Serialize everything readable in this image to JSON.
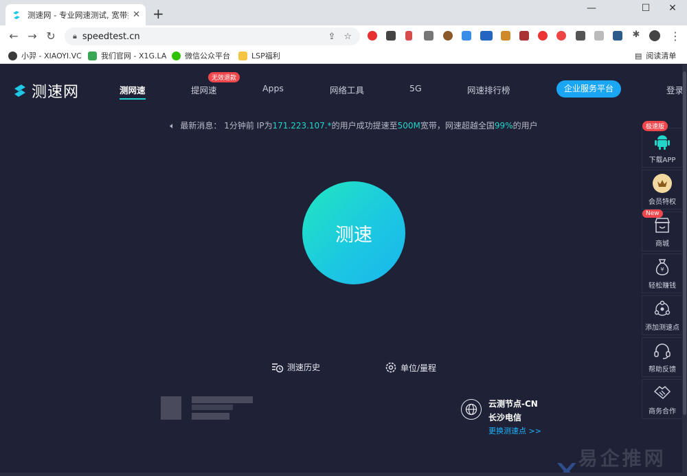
{
  "browser": {
    "tab_title": "测速网 - 专业网速测试, 宽带提速",
    "url": "speedtest.cn",
    "window_controls": {
      "minimize": "—",
      "maximize": "☐",
      "close": "✕"
    }
  },
  "bookmarks": [
    {
      "label": "小羿 - XIAOYI.VC",
      "color": "#3a3a3a"
    },
    {
      "label": "我们官网 - X1G.LA",
      "color": "#3aa756"
    },
    {
      "label": "微信公众平台",
      "color": "#2dc100"
    },
    {
      "label": "LSP福利",
      "color": "#f4c542"
    }
  ],
  "reading_list": "阅读清单",
  "site": {
    "logo": "测速网",
    "nav": [
      {
        "label": "测网速",
        "active": true
      },
      {
        "label": "提网速",
        "active": false
      },
      {
        "label": "Apps",
        "active": false
      },
      {
        "label": "网络工具",
        "active": false
      },
      {
        "label": "5G",
        "active": false
      },
      {
        "label": "网速排行榜",
        "active": false
      }
    ],
    "nav_badge": "无效退款",
    "enterprise": "企业服务平台",
    "login": "登录",
    "news": {
      "prefix": "最新消息：  1分钟前 IP为",
      "ip": "171.223.107.*",
      "mid": "的用户成功提速至",
      "speed": "500M",
      "mid2": "宽带，网速超越全国",
      "pct": "99%",
      "suffix": "的用户"
    },
    "speed_button": "测速",
    "history": "测速历史",
    "units": "单位/量程",
    "node": {
      "name": "云测节点-CN",
      "isp": "长沙电信",
      "change": "更换测速点 >>"
    },
    "sidebar": [
      {
        "label": "下载APP",
        "badge": "极速版"
      },
      {
        "label": "会员特权",
        "badge": ""
      },
      {
        "label": "商城",
        "badge": "New"
      },
      {
        "label": "轻松赚钱",
        "badge": ""
      },
      {
        "label": "添加测速点",
        "badge": ""
      },
      {
        "label": "帮助反馈",
        "badge": ""
      },
      {
        "label": "商务合作",
        "badge": ""
      }
    ]
  },
  "watermark": "易企推网络",
  "colors": {
    "accent": "#1fd3d3",
    "highlight": "#21d5c9",
    "link": "#1fb4ff",
    "enterprise": "#1aa6f2",
    "badge": "#f0474c",
    "background": "#1f2236"
  }
}
